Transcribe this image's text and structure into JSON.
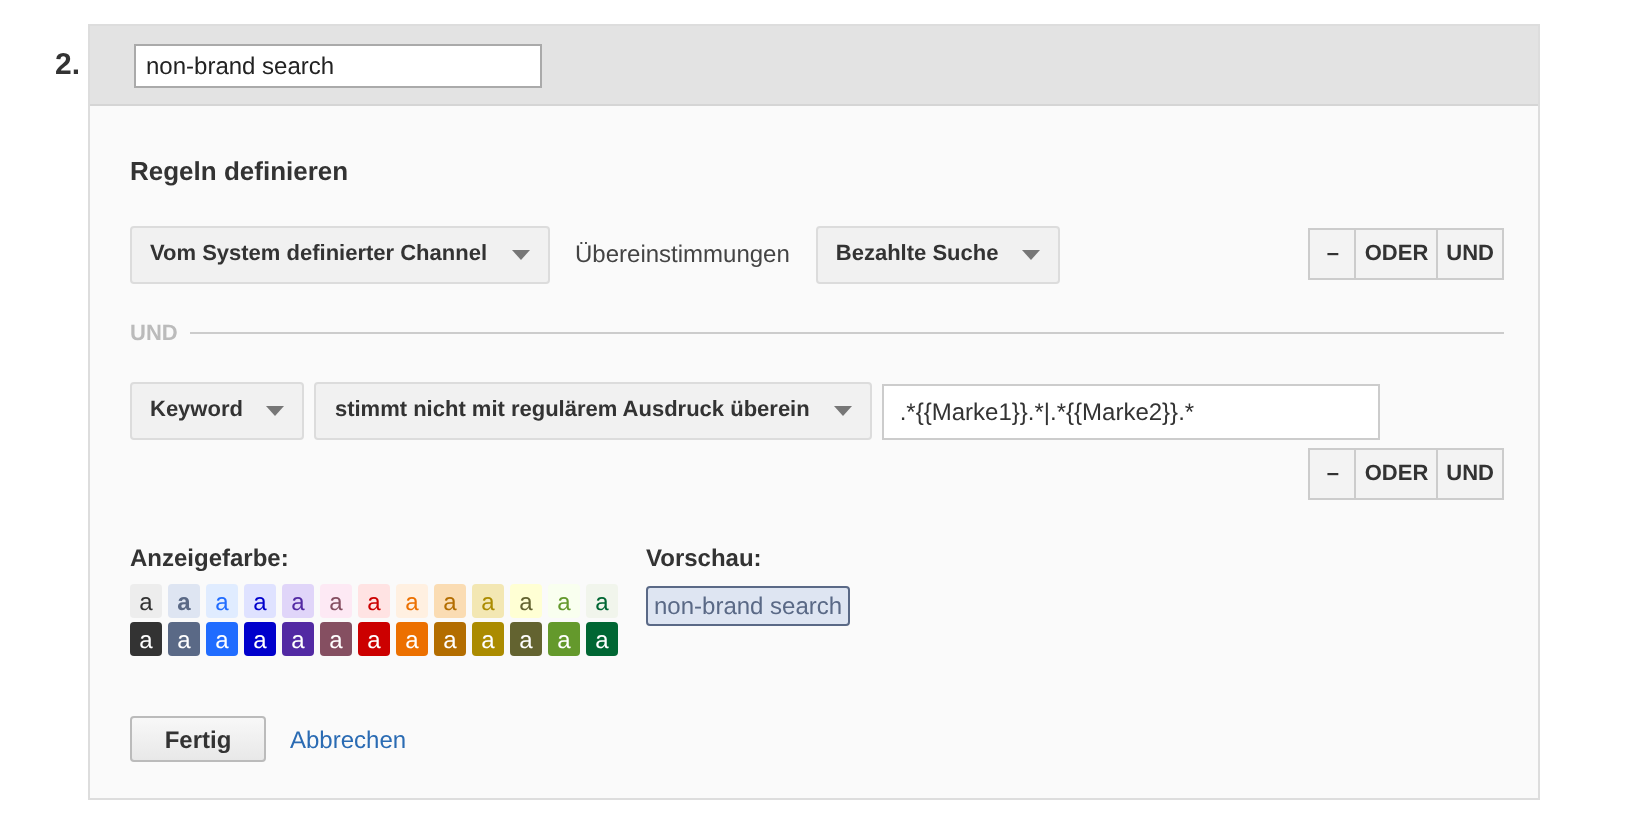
{
  "step_number": "2.",
  "name_field": {
    "value": "non-brand search"
  },
  "rules": {
    "title": "Regeln definieren",
    "conditions": [
      {
        "dimension": "Vom System definierter Channel",
        "operator": {
          "kind": "text",
          "text": "Übereinstimmungen"
        },
        "value": {
          "kind": "select",
          "text": "Bezahlte Suche"
        },
        "buttons": [
          "–",
          "ODER",
          "UND"
        ]
      },
      {
        "dimension": "Keyword",
        "operator": {
          "kind": "select",
          "text": "stimmt nicht mit regulärem Ausdruck überein"
        },
        "value": {
          "kind": "input",
          "text": ".*{{Marke1}}.*|.*{{Marke2}}.*"
        },
        "buttons": [
          "–",
          "ODER",
          "UND"
        ]
      }
    ],
    "separator": "UND"
  },
  "color_label": "Anzeigefarbe:",
  "swatches": [
    {
      "letter": "a",
      "kind": "light",
      "color": "#ededed",
      "selected": false
    },
    {
      "letter": "a",
      "kind": "light",
      "color": "#dee5f2",
      "selected": true
    },
    {
      "letter": "a",
      "kind": "light",
      "color": "#e0ecff",
      "selected": false
    },
    {
      "letter": "a",
      "kind": "light",
      "color": "#dfe2ff",
      "selected": false
    },
    {
      "letter": "a",
      "kind": "light",
      "color": "#e0d5f9",
      "selected": false
    },
    {
      "letter": "a",
      "kind": "light",
      "color": "#fde9f4",
      "selected": false
    },
    {
      "letter": "a",
      "kind": "light",
      "color": "#ffe3e3",
      "selected": false
    },
    {
      "letter": "a",
      "kind": "light",
      "color": "#fff0e1",
      "selected": false
    },
    {
      "letter": "a",
      "kind": "light",
      "color": "#fadcb3",
      "selected": false
    },
    {
      "letter": "a",
      "kind": "light",
      "color": "#f3e7b3",
      "selected": false
    },
    {
      "letter": "a",
      "kind": "light",
      "color": "#ffffd4",
      "selected": false
    },
    {
      "letter": "a",
      "kind": "light",
      "color": "#f9ffef",
      "selected": false
    },
    {
      "letter": "a",
      "kind": "light",
      "color": "#f1f5ec",
      "selected": false
    },
    {
      "letter": "a",
      "kind": "dark",
      "color": "#333333",
      "selected": false
    },
    {
      "letter": "a",
      "kind": "dark",
      "color": "#5a6986",
      "selected": false
    },
    {
      "letter": "a",
      "kind": "dark",
      "color": "#206cff",
      "selected": false
    },
    {
      "letter": "a",
      "kind": "dark",
      "color": "#0000cc",
      "selected": false
    },
    {
      "letter": "a",
      "kind": "dark",
      "color": "#5229a3",
      "selected": false
    },
    {
      "letter": "a",
      "kind": "dark",
      "color": "#854f61",
      "selected": false
    },
    {
      "letter": "a",
      "kind": "dark",
      "color": "#cc0000",
      "selected": false
    },
    {
      "letter": "a",
      "kind": "dark",
      "color": "#ec7000",
      "selected": false
    },
    {
      "letter": "a",
      "kind": "dark",
      "color": "#b36d00",
      "selected": false
    },
    {
      "letter": "a",
      "kind": "dark",
      "color": "#ab8b00",
      "selected": false
    },
    {
      "letter": "a",
      "kind": "dark",
      "color": "#636330",
      "selected": false
    },
    {
      "letter": "a",
      "kind": "dark",
      "color": "#64992c",
      "selected": false
    },
    {
      "letter": "a",
      "kind": "dark",
      "color": "#006633",
      "selected": false
    }
  ],
  "preview_label": "Vorschau:",
  "preview_text": "non-brand search",
  "buttons": {
    "done": "Fertig",
    "cancel": "Abbrechen"
  }
}
